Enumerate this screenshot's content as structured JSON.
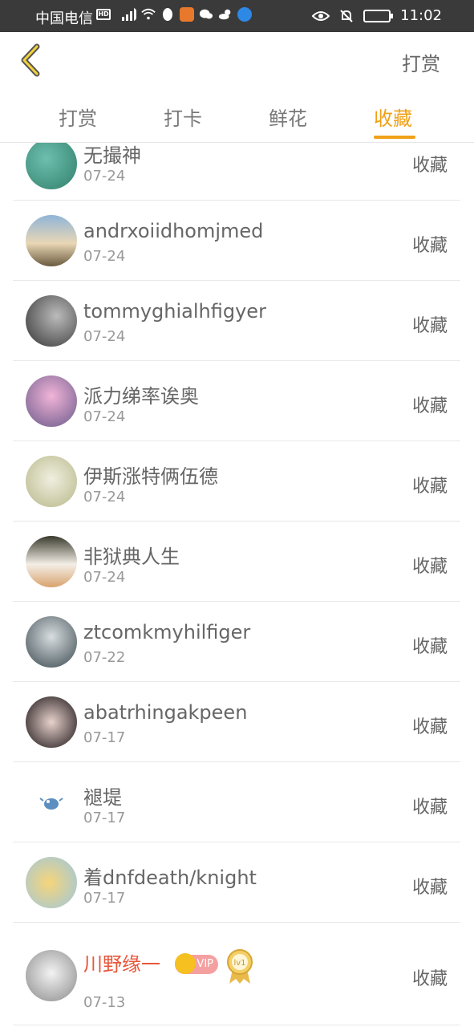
{
  "status_bar": {
    "carrier": "中国电信",
    "hd": "HD",
    "time": "11:02",
    "icons": [
      "hd-icon",
      "signal-icon",
      "wifi-icon",
      "qq-icon",
      "app-icon",
      "wechat-icon",
      "weather-icon",
      "browser-icon",
      "eye-icon",
      "mute-icon",
      "battery-icon"
    ]
  },
  "header": {
    "back_icon": "chevron-left-icon",
    "right_label": "打赏"
  },
  "tabs": [
    {
      "label": "打赏",
      "active": false
    },
    {
      "label": "打卡",
      "active": false
    },
    {
      "label": "鲜花",
      "active": false
    },
    {
      "label": "收藏",
      "active": true
    }
  ],
  "colors": {
    "accent": "#f0a117",
    "vip_name": "#e8563a",
    "status_bar_bg": "#3a3a3a"
  },
  "items": [
    {
      "name": "无撮神",
      "date": "07-24",
      "action": "收藏"
    },
    {
      "name": "andrxoiidhomjmed",
      "date": "07-24",
      "action": "收藏"
    },
    {
      "name": "tommyghialhfigyer",
      "date": "07-24",
      "action": "收藏"
    },
    {
      "name": "派力绨率诶奥",
      "date": "07-24",
      "action": "收藏"
    },
    {
      "name": "伊斯涨特俩伍德",
      "date": "07-24",
      "action": "收藏"
    },
    {
      "name": "非狱典人生",
      "date": "07-24",
      "action": "收藏"
    },
    {
      "name": "ztcomkmyhilfiger",
      "date": "07-22",
      "action": "收藏"
    },
    {
      "name": "abatrhingakpeen",
      "date": "07-17",
      "action": "收藏"
    },
    {
      "name": "褪堤",
      "date": "07-17",
      "action": "收藏"
    },
    {
      "name": "着dnfdeath/knight",
      "date": "07-17",
      "action": "收藏"
    },
    {
      "name": "川野缘一",
      "date": "07-13",
      "action": "收藏",
      "vip": true,
      "vip_label": "VIP",
      "level": "lv1"
    }
  ]
}
